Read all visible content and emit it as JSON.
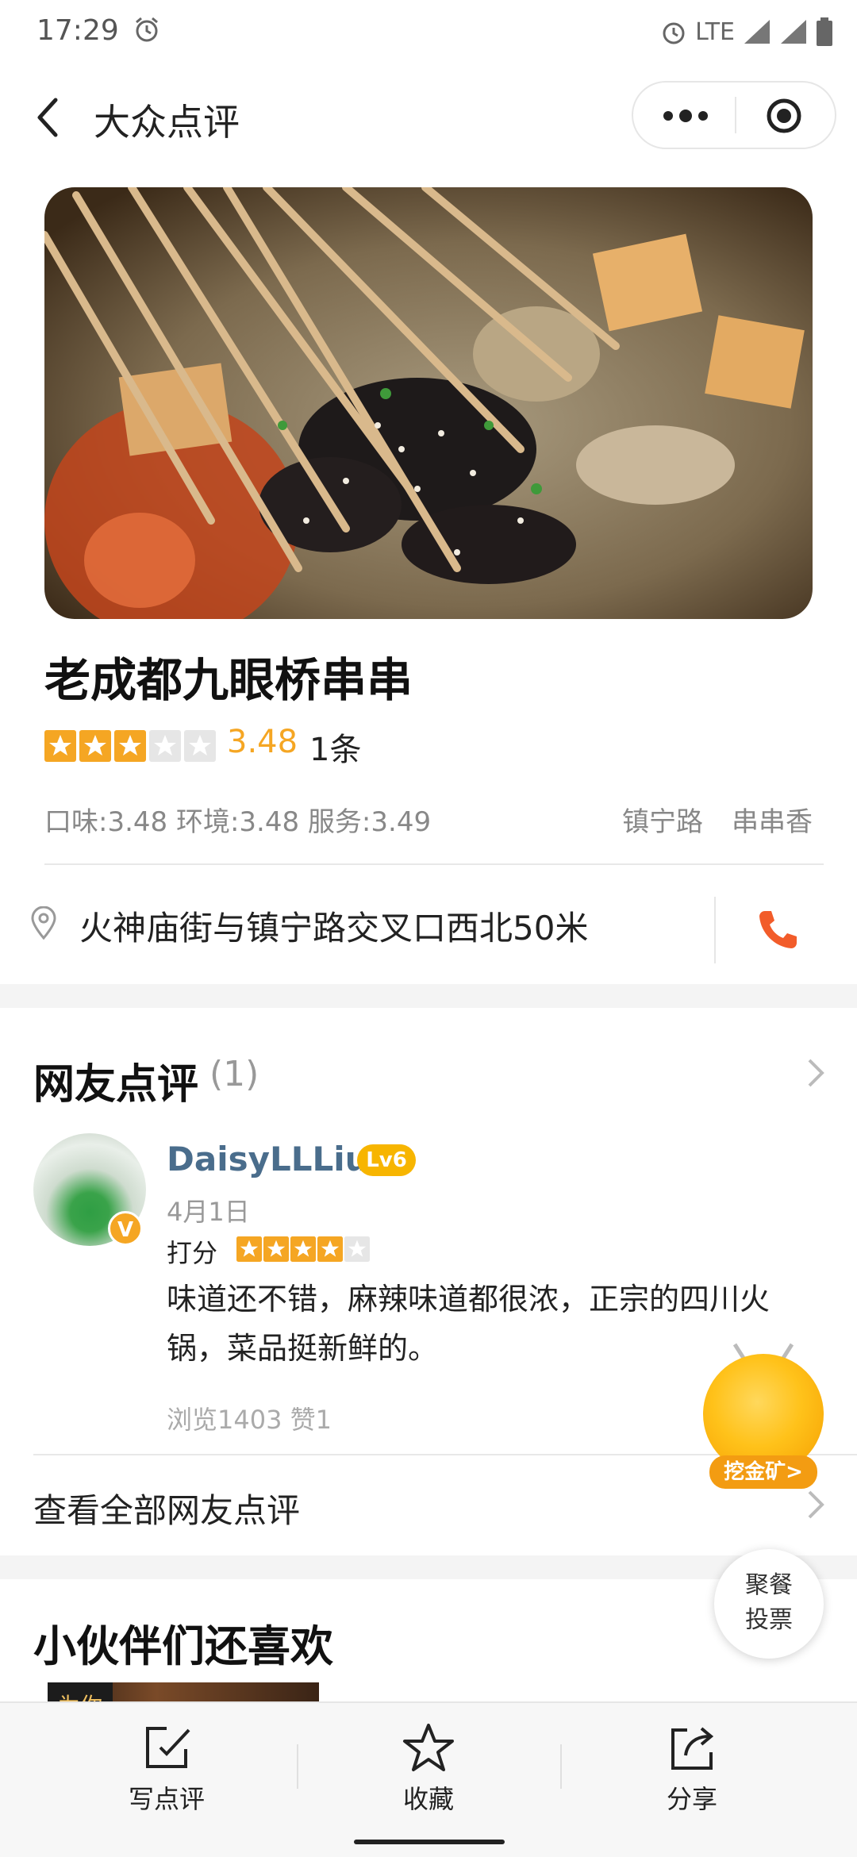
{
  "status_bar": {
    "time": "17:29",
    "network": "LTE"
  },
  "nav": {
    "title": "大众点评"
  },
  "shop": {
    "name": "老成都九眼桥串串",
    "rating": 3.48,
    "rating_text": "3.48",
    "review_count_text": "1条",
    "sub_scores": "口味:3.48 环境:3.48 服务:3.49",
    "tags": [
      "镇宁路",
      "串串香"
    ],
    "address": "火神庙街与镇宁路交叉口西北50米"
  },
  "reviews": {
    "title": "网友点评",
    "count_text": "(1)",
    "item": {
      "user": "DaisyLLLiu",
      "level": "Lv6",
      "verified_badge": "V",
      "date": "4月1日",
      "score_label": "打分",
      "score_stars": 4,
      "text": "味道还不错，麻辣味道都很浓，正宗的四川火锅，菜品挺新鲜的。",
      "stats": "浏览1403 赞1"
    },
    "see_all": "查看全部网友点评"
  },
  "recommend": {
    "title": "小伙伴们还喜欢",
    "thumb_label": "为你"
  },
  "floating": {
    "mine_label": "挖金矿>",
    "vote_line1": "聚餐",
    "vote_line2": "投票"
  },
  "bottom_bar": {
    "tabs": [
      {
        "label": "写点评",
        "icon": "edit-icon"
      },
      {
        "label": "收藏",
        "icon": "star-icon"
      },
      {
        "label": "分享",
        "icon": "share-icon"
      }
    ]
  },
  "colors": {
    "accent": "#f5a623",
    "phone": "#f25c2a",
    "username": "#4a6d8c"
  }
}
